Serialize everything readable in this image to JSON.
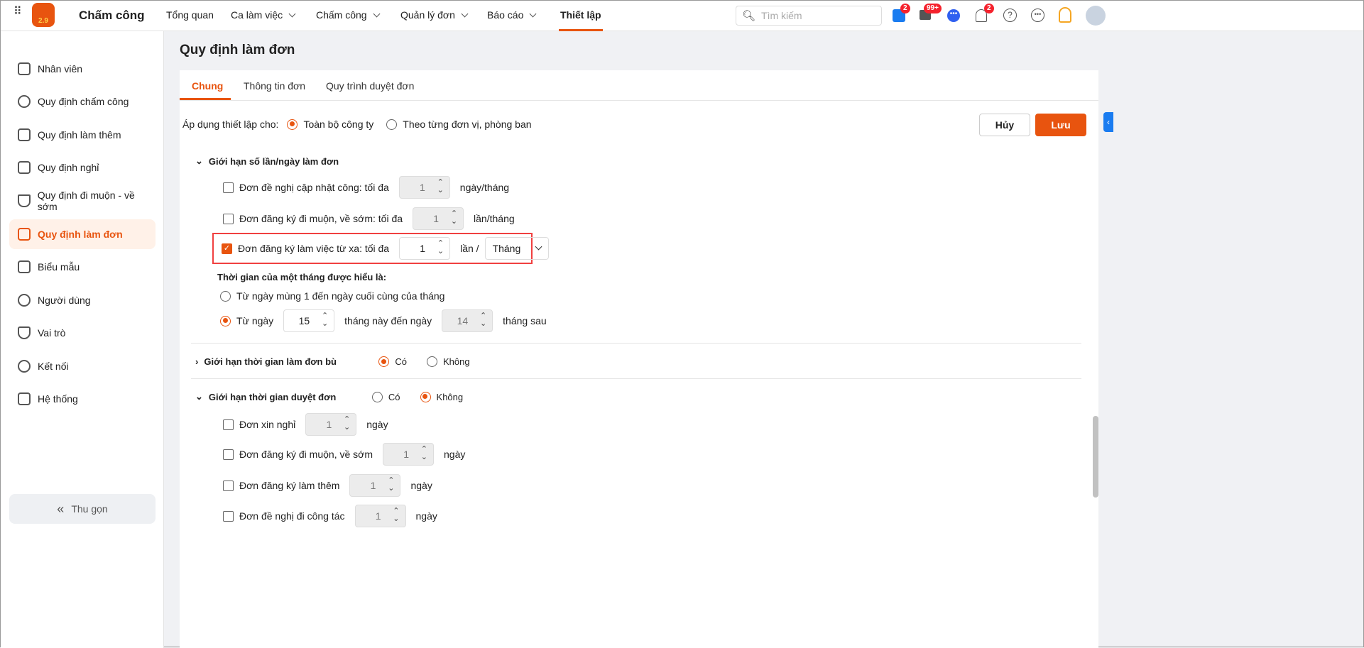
{
  "app": {
    "title": "Chấm công",
    "logo_text": "2.9"
  },
  "nav": [
    {
      "label": "Tổng quan",
      "dd": false
    },
    {
      "label": "Ca làm việc",
      "dd": true
    },
    {
      "label": "Chấm công",
      "dd": true
    },
    {
      "label": "Quản lý đơn",
      "dd": true
    },
    {
      "label": "Báo cáo",
      "dd": true
    },
    {
      "label": "Thiết lập",
      "dd": false,
      "active": true
    }
  ],
  "search": {
    "placeholder": "Tìm kiếm"
  },
  "badges": {
    "cart": "2",
    "megaphone": "99+",
    "bell": "2"
  },
  "sidebar": {
    "items": [
      "Nhân viên",
      "Quy định chấm công",
      "Quy định làm thêm",
      "Quy định nghỉ",
      "Quy định đi muộn - về sớm",
      "Quy định làm đơn",
      "Biểu mẫu",
      "Người dùng",
      "Vai trò",
      "Kết nối",
      "Hệ thống"
    ],
    "active": 5,
    "collapse": "Thu gọn"
  },
  "page": {
    "title": "Quy định làm đơn",
    "tabs": [
      "Chung",
      "Thông tin đơn",
      "Quy trình duyệt đơn"
    ]
  },
  "apply": {
    "label": "Áp dụng thiết lập cho:",
    "opt1": "Toàn bộ công ty",
    "opt2": "Theo từng đơn vị, phòng ban",
    "cancel": "Hủy",
    "save": "Lưu"
  },
  "limit": {
    "title": "Giới hạn số lần/ngày làm đơn",
    "r1": {
      "label": "Đơn đề nghị cập nhật công: tối đa",
      "value": "1",
      "unit": "ngày/tháng"
    },
    "r2": {
      "label": "Đơn đăng ký đi muộn, về sớm: tối đa",
      "value": "1",
      "unit": "lần/tháng"
    },
    "r3": {
      "label": "Đơn đăng ký làm việc từ xa: tối đa",
      "value": "1",
      "unit": "lần /",
      "period": "Tháng"
    },
    "month_title": "Thời gian của một tháng được hiểu là:",
    "m1": "Từ ngày mùng 1 đến ngày cuối cùng của tháng",
    "m2": "Từ ngày",
    "m2_from": "15",
    "m2_mid": "tháng này đến ngày",
    "m2_to": "14",
    "m2_end": "tháng sau"
  },
  "comp": {
    "title": "Giới hạn thời gian làm đơn bù",
    "yes": "Có",
    "no": "Không"
  },
  "approve": {
    "title": "Giới hạn thời gian duyệt đơn",
    "yes": "Có",
    "no": "Không",
    "rows": [
      {
        "label": "Đơn xin nghỉ",
        "value": "1",
        "unit": "ngày"
      },
      {
        "label": "Đơn đăng ký đi muộn, về sớm",
        "value": "1",
        "unit": "ngày"
      },
      {
        "label": "Đơn đăng ký làm thêm",
        "value": "1",
        "unit": "ngày"
      },
      {
        "label": "Đơn đề nghị đi công tác",
        "value": "1",
        "unit": "ngày"
      }
    ]
  }
}
